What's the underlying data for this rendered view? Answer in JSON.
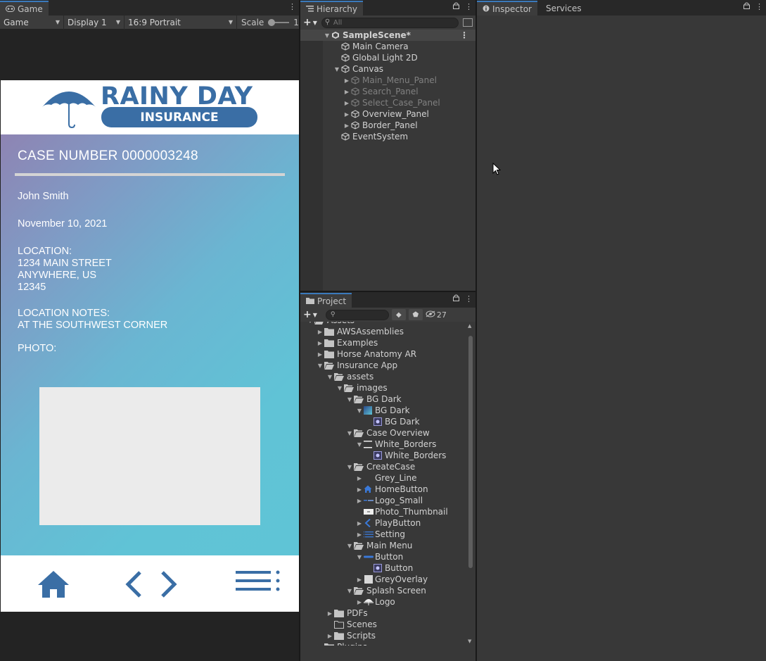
{
  "game": {
    "tab_label": "Game",
    "mode": "Game",
    "display": "Display 1",
    "aspect": "16:9 Portrait",
    "scale_label": "Scale",
    "scale_value": "1",
    "app": {
      "logo_line1": "RAINY DAY",
      "logo_line2": "INSURANCE",
      "case_number": "CASE NUMBER 0000003248",
      "name": "John Smith",
      "date": "November 10, 2021",
      "location_label": "LOCATION:",
      "address1": "1234 MAIN STREET",
      "address2": "ANYWHERE, US",
      "address3": "12345",
      "notes_label": "LOCATION NOTES:",
      "notes": "AT THE SOUTHWEST CORNER",
      "photo_label": "PHOTO:",
      "accent": "#3a6ea5"
    }
  },
  "hierarchy": {
    "tab_label": "Hierarchy",
    "search_placeholder": "All",
    "items": [
      {
        "label": "SampleScene*",
        "depth": 0,
        "expanded": true,
        "scene": true
      },
      {
        "label": "Main Camera",
        "depth": 1
      },
      {
        "label": "Global Light 2D",
        "depth": 1
      },
      {
        "label": "Canvas",
        "depth": 1,
        "expanded": true
      },
      {
        "label": "Main_Menu_Panel",
        "depth": 2,
        "collapsed": true,
        "dim": true
      },
      {
        "label": "Search_Panel",
        "depth": 2,
        "collapsed": true,
        "dim": true
      },
      {
        "label": "Select_Case_Panel",
        "depth": 2,
        "collapsed": true,
        "dim": true
      },
      {
        "label": "Overview_Panel",
        "depth": 2,
        "collapsed": true
      },
      {
        "label": "Border_Panel",
        "depth": 2,
        "collapsed": true
      },
      {
        "label": "EventSystem",
        "depth": 1
      }
    ]
  },
  "project": {
    "tab_label": "Project",
    "hidden_count": "27",
    "items": [
      {
        "label": "Assets",
        "depth": 0,
        "icon": "folder-open",
        "tri": "down",
        "clipped": true
      },
      {
        "label": "AWSAssemblies",
        "depth": 1,
        "icon": "folder",
        "tri": "right"
      },
      {
        "label": "Examples",
        "depth": 1,
        "icon": "folder",
        "tri": "right"
      },
      {
        "label": "Horse Anatomy AR",
        "depth": 1,
        "icon": "folder",
        "tri": "right"
      },
      {
        "label": "Insurance App",
        "depth": 1,
        "icon": "folder-open",
        "tri": "down"
      },
      {
        "label": "assets",
        "depth": 2,
        "icon": "folder-open",
        "tri": "down"
      },
      {
        "label": "images",
        "depth": 3,
        "icon": "folder-open",
        "tri": "down"
      },
      {
        "label": "BG Dark",
        "depth": 4,
        "icon": "folder-open",
        "tri": "down"
      },
      {
        "label": "BG Dark",
        "depth": 5,
        "icon": "texture-gradient",
        "tri": "down"
      },
      {
        "label": "BG Dark",
        "depth": 6,
        "icon": "sprite"
      },
      {
        "label": "Case Overview",
        "depth": 4,
        "icon": "folder-open",
        "tri": "down"
      },
      {
        "label": "White_Borders",
        "depth": 5,
        "icon": "texture-borders",
        "tri": "down"
      },
      {
        "label": "White_Borders",
        "depth": 6,
        "icon": "sprite"
      },
      {
        "label": "CreateCase",
        "depth": 4,
        "icon": "folder-open",
        "tri": "down"
      },
      {
        "label": "Grey_Line",
        "depth": 5,
        "icon": "none",
        "tri": "right"
      },
      {
        "label": "HomeButton",
        "depth": 5,
        "icon": "home",
        "tri": "right"
      },
      {
        "label": "Logo_Small",
        "depth": 5,
        "icon": "logo-small",
        "tri": "right"
      },
      {
        "label": "Photo_Thumbnail",
        "depth": 5,
        "icon": "thumb"
      },
      {
        "label": "PlayButton",
        "depth": 5,
        "icon": "chevron",
        "tri": "right"
      },
      {
        "label": "Setting",
        "depth": 5,
        "icon": "menu-lines",
        "tri": "right"
      },
      {
        "label": "Main Menu",
        "depth": 4,
        "icon": "folder-open",
        "tri": "down"
      },
      {
        "label": "Button",
        "depth": 5,
        "icon": "button-bar",
        "tri": "down"
      },
      {
        "label": "Button",
        "depth": 6,
        "icon": "sprite"
      },
      {
        "label": "GreyOverlay",
        "depth": 5,
        "icon": "grey-square",
        "tri": "right"
      },
      {
        "label": "Splash Screen",
        "depth": 4,
        "icon": "folder-open",
        "tri": "down"
      },
      {
        "label": "Logo",
        "depth": 5,
        "icon": "umbrella",
        "tri": "right"
      },
      {
        "label": "PDFs",
        "depth": 2,
        "icon": "folder",
        "tri": "right"
      },
      {
        "label": "Scenes",
        "depth": 2,
        "icon": "folder-empty"
      },
      {
        "label": "Scripts",
        "depth": 2,
        "icon": "folder",
        "tri": "right"
      },
      {
        "label": "Plugins",
        "depth": 1,
        "icon": "folder",
        "tri": "right",
        "clipped": true
      }
    ]
  },
  "inspector": {
    "tab_label": "Inspector",
    "services_label": "Services"
  }
}
